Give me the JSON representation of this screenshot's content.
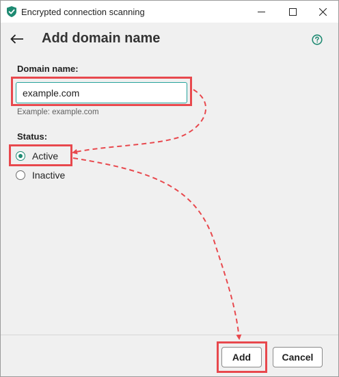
{
  "window": {
    "title": "Encrypted connection scanning",
    "app_icon": "shield-check-icon",
    "controls": [
      "minimize-icon",
      "maximize-icon",
      "close-icon"
    ]
  },
  "header": {
    "back_icon": "arrow-left-icon",
    "title": "Add domain name",
    "help_icon": "question-circle-icon"
  },
  "form": {
    "domain_label": "Domain name:",
    "domain_value": "example.com",
    "domain_hint": "Example: example.com",
    "status_label": "Status:",
    "status_options": [
      {
        "label": "Active",
        "checked": true
      },
      {
        "label": "Inactive",
        "checked": false
      }
    ]
  },
  "footer": {
    "add_label": "Add",
    "cancel_label": "Cancel"
  },
  "colors": {
    "accent": "#1e8a72",
    "highlight": "#e8484d",
    "input_border": "#24a19a"
  }
}
